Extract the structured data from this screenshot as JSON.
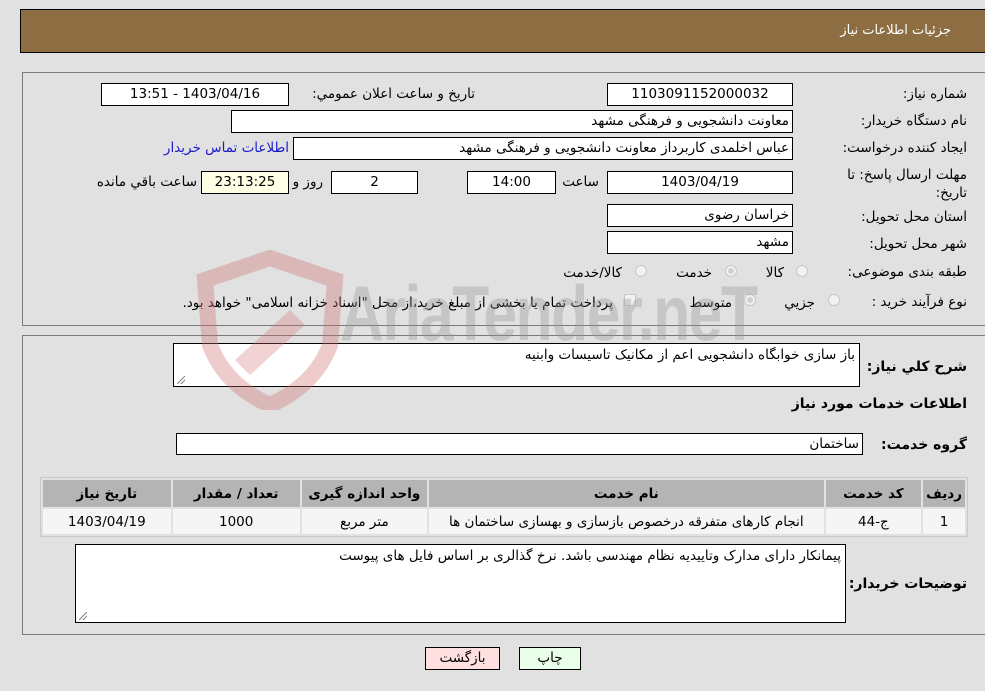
{
  "header": {
    "title": "جزئيات اطلاعات نياز"
  },
  "details": {
    "need_number": {
      "label": "شماره نیاز:",
      "value": "1103091152000032"
    },
    "announce_datetime": {
      "label": "تاریخ و ساعت اعلان عمومي:",
      "value": "1403/04/16 - 13:51"
    },
    "buyer_org": {
      "label": "نام دستگاه خریدار:",
      "value": "معاونت دانشجویی و فرهنگی مشهد"
    },
    "requester": {
      "label": "ایجاد کننده درخواست:",
      "value": "عباس اخلمدی کاربرداز معاونت دانشجویی و فرهنگی مشهد"
    },
    "buyer_contact_link": "اطلاعات تماس خریدار",
    "deadline": {
      "label": "مهلت ارسال پاسخ: تا تاریخ:",
      "date": "1403/04/19",
      "time_label": "ساعت",
      "time": "14:00",
      "days": "2",
      "days_label": "روز و",
      "remaining": "23:13:25",
      "remaining_label": "ساعت باقي مانده"
    },
    "province": {
      "label": "استان محل تحویل:",
      "value": "خراسان رضوی"
    },
    "city": {
      "label": "شهر محل تحویل:",
      "value": "مشهد"
    },
    "category": {
      "label": "طبقه بندی موضوعی:",
      "options": [
        "کالا",
        "خدمت",
        "کالا/خدمت"
      ],
      "selected": "خدمت"
    },
    "purchase_type": {
      "label": "نوع فرآیند خرید :",
      "options": [
        "جزيي",
        "متوسط"
      ],
      "selected": "متوسط",
      "treasury_note": "پرداخت تمام یا بخشی از مبلغ خرید،از محل \"اسناد خزانه اسلامی\" خواهد بود."
    }
  },
  "description": {
    "label": "شرح كلي نياز:",
    "value": "باز سازی خوابگاه دانشجویی اعم از مکانیک تاسیسات وابنیه"
  },
  "services": {
    "title": "اطلاعات خدمات مورد نياز",
    "group_label": "گروه خدمت:",
    "group_value": "ساختمان",
    "columns": [
      "ردیف",
      "کد خدمت",
      "نام خدمت",
      "واحد اندازه گیری",
      "تعداد / مقدار",
      "تاریخ نیاز"
    ],
    "rows": [
      [
        "1",
        "ج-44",
        "انجام کارهای متفرقه درخصوص بازسازی و بهسازی ساختمان ها",
        "متر مربع",
        "1000",
        "1403/04/19"
      ]
    ]
  },
  "buyer_notes": {
    "label": "توضيحات خريدار:",
    "value": "پیمانکار دارای مدارک وتاییدیه نظام مهندسی باشد.  نرخ گذالری بر اساس فایل های پیوست"
  },
  "buttons": {
    "print": "چاپ",
    "back": "بازگشت"
  },
  "watermark": {
    "text": "AriaTender.neT"
  },
  "colors": {
    "header_bg": "#8d6e42",
    "print_bg": "#eaffea",
    "back_bg": "#ffe0e0",
    "link": "#1a1acc"
  }
}
